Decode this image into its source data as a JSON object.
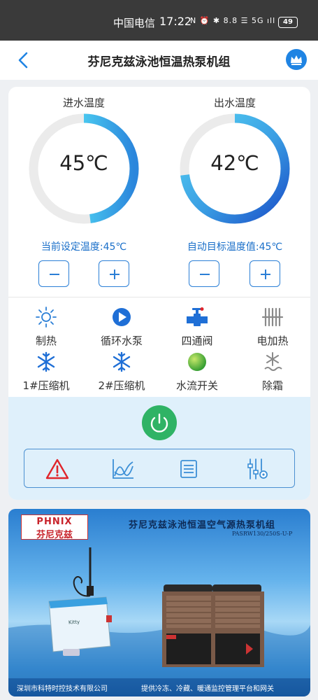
{
  "status_bar": {
    "carrier": "中国电信",
    "time": "17:22",
    "indicators": "N ⏰ ✱ 8.8 ☰ 5G ıll",
    "battery": "49"
  },
  "header": {
    "title": "芬尼克兹泳池恒温热泵机组",
    "back_icon": "chevron-left-icon",
    "crown_icon": "crown-icon"
  },
  "inlet": {
    "label": "进水温度",
    "value": "45℃",
    "fill": 0.48,
    "setpoint": "当前设定温度:45℃"
  },
  "outlet": {
    "label": "出水温度",
    "value": "42℃",
    "fill": 0.73,
    "setpoint": "自动目标温度值:45℃"
  },
  "steppers": {
    "minus": "minus-icon",
    "plus": "plus-icon"
  },
  "status_items": [
    {
      "label": "制热",
      "icon": "sun-icon"
    },
    {
      "label": "循环水泵",
      "icon": "pump-icon"
    },
    {
      "label": "四通阀",
      "icon": "valve-icon"
    },
    {
      "label": "电加热",
      "icon": "heater-icon"
    },
    {
      "label": "1#压缩机",
      "icon": "snowflake-icon"
    },
    {
      "label": "2#压缩机",
      "icon": "snowflake-icon"
    },
    {
      "label": "水流开关",
      "icon": "flow-switch-icon"
    },
    {
      "label": "除霜",
      "icon": "defrost-icon"
    }
  ],
  "toolbar": {
    "items": [
      "alarm-icon",
      "curve-chart-icon",
      "list-icon",
      "settings-sliders-icon"
    ]
  },
  "colors": {
    "accent": "#1f84e3",
    "gauge_track": "#ebebeb",
    "power": "#2fb365",
    "alarm": "#e0252b"
  },
  "banner": {
    "logo_en": "PHNIX",
    "logo_cn": "芬尼克兹",
    "title": "芬尼克兹泳池恒温空气源热泵机组",
    "model": "PASRW130/250S-U-P",
    "device_brand": "Kitty",
    "footer_left": "深圳市科特时控技术有限公司",
    "footer_right": "提供冷冻、冷藏、暖通监控管理平台和网关"
  }
}
